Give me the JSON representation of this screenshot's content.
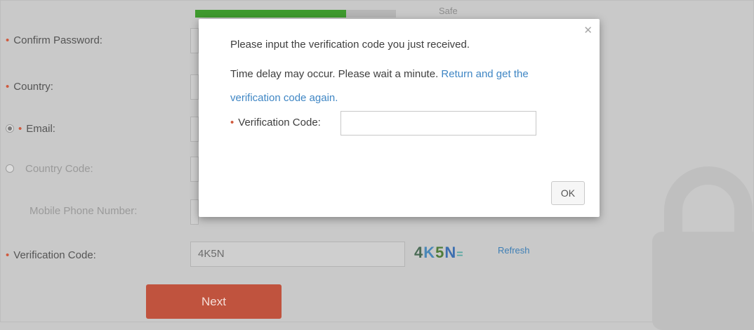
{
  "strength": {
    "label": "Safe",
    "level": 0.75,
    "fill_color": "#3f9a2e"
  },
  "form": {
    "confirm_password_label": "Confirm Password:",
    "country_label": "Country:",
    "email_label": "Email:",
    "country_code_label": "Country Code:",
    "mobile_label": "Mobile Phone Number:",
    "verification_label": "Verification Code:",
    "verification_value": "4K5N",
    "captcha_chars": [
      "4",
      "K",
      "5",
      "N",
      "="
    ],
    "refresh_label": "Refresh",
    "next_label": "Next",
    "email_selected": true
  },
  "modal": {
    "line1": "Please input the verification code you just received.",
    "line2_text": "Time delay may occur. Please wait a minute.",
    "line2_link": "Return and get the verification code again.",
    "code_label": "Verification Code:",
    "code_value": "",
    "ok_label": "OK",
    "close_icon": "close-icon"
  },
  "colors": {
    "accent": "#c0533e",
    "link": "#3f86c4",
    "required": "#d05a3e"
  }
}
